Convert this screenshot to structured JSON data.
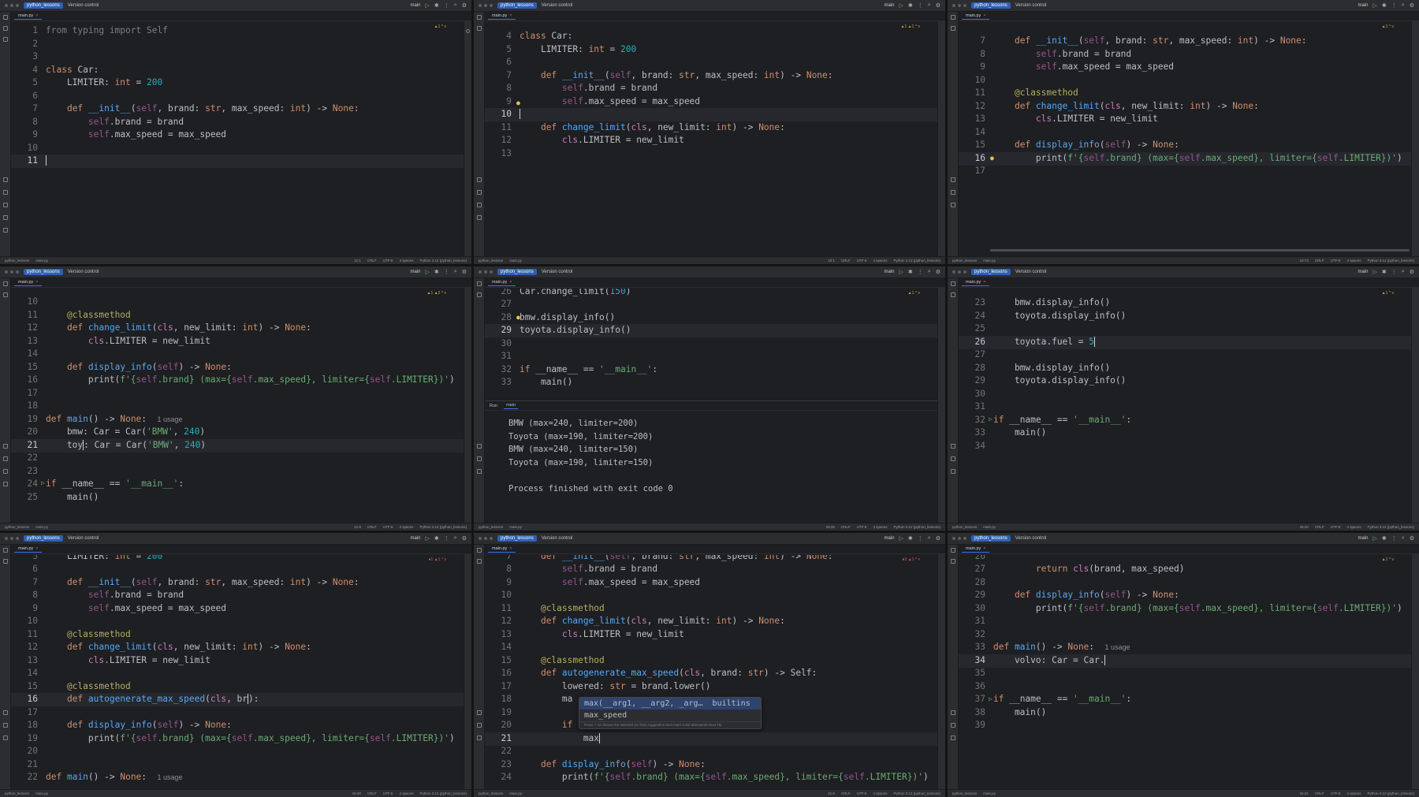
{
  "colors": {
    "accent": "#3574f0",
    "keyword": "#cf8e6d",
    "function": "#56a8f5",
    "number": "#2aacb8",
    "string": "#6aab73",
    "self": "#94558d",
    "decorator": "#b3ae60",
    "run": "#5fb865"
  },
  "toolbar": {
    "project": "python_lessons",
    "vcs": "Version control",
    "branch": "main"
  },
  "tab": {
    "file": "main.py"
  },
  "status": {
    "path_root": "python_lessons",
    "path_file": "main.py",
    "crlf": "CRLF",
    "encoding": "UTF-8",
    "indent": "4 spaces",
    "interpreter": "Python 3.12 (python_lessons)",
    "p1_pos": "11:1",
    "p2_pos": "10:1",
    "p3_pos": "16:74",
    "p4_pos": "21:8",
    "p5_pos": "29:25",
    "p6_pos": "26:20",
    "p7_pos": "16:38",
    "p8_pos": "21:8",
    "p9_pos": "34:21"
  },
  "run": {
    "label": "Run",
    "config": "main",
    "output": [
      "BMW (max=240, limiter=200)",
      "Toyota (max=190, limiter=200)",
      "BMW (max=240, limiter=150)",
      "Toyota (max=190, limiter=150)",
      "",
      "Process finished with exit code 0"
    ]
  },
  "popup": {
    "item1": "max(__arg1, __arg2, _arg…  builtins",
    "item2": "max_speed",
    "hint": "Press ^. to choose the selected (or first) suggestion and insert a dot afterwards  Next Tip"
  },
  "usage": "1 usage"
}
